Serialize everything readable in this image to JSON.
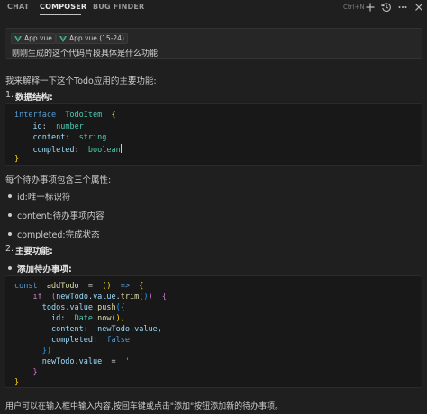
{
  "tabs": [
    {
      "label": "CHAT",
      "active": false
    },
    {
      "label": "COMPOSER",
      "active": true
    },
    {
      "label": "BUG FINDER",
      "active": false
    }
  ],
  "toolbar": {
    "shortcut": "Ctrl+N",
    "icons": [
      "plus-icon",
      "history-icon",
      "more-icon",
      "close-icon"
    ]
  },
  "context": {
    "chips": [
      "App.vue",
      "App.vue (15-24)"
    ],
    "question": "刚刚生成的这个代码片段具体是什么功能"
  },
  "answer": {
    "intro": "我来解释一下这个Todo应用的主要功能:",
    "section1_num": "1.",
    "section1_title": "数据结构:",
    "code1": {
      "line1": {
        "kw": "interface",
        "name": "TodoItem",
        "open": "{"
      },
      "line2": {
        "prop": "id",
        "type": "number"
      },
      "line3": {
        "prop": "content",
        "type": "string"
      },
      "line4": {
        "prop": "completed",
        "type": "boolean"
      },
      "line5": {
        "close": "}"
      }
    },
    "props_intro": "每个待办事项包含三个属性:",
    "props": [
      "id:唯一标识符",
      "content:待办事项内容",
      "completed:完成状态"
    ],
    "section2_num": "2.",
    "section2_title": "主要功能:",
    "bullet2_title": "添加待办事项:",
    "code2": {
      "l1": {
        "kw": "const",
        "name": "addTodo",
        "eq": "=",
        "params": "()",
        "arrow": "=>",
        "open": "{"
      },
      "l2": {
        "kw": "if",
        "cond_open": "(",
        "obj": "newTodo",
        "dot1": ".",
        "val": "value",
        "dot2": ".",
        "fn": "trim",
        "call": "()",
        "cond_close": ")",
        "open": "{"
      },
      "l3": {
        "obj": "todos",
        "dot1": ".",
        "val": "value",
        "dot2": ".",
        "fn": "push",
        "open": "({"
      },
      "l4": {
        "prop": "id",
        "obj": "Date",
        "dot": ".",
        "fn": "now",
        "call": "(),"
      },
      "l5": {
        "prop": "content",
        "obj": "newTodo",
        "dot": ".",
        "val": "value",
        "comma": ","
      },
      "l6": {
        "prop": "completed",
        "val": "false"
      },
      "l7": {
        "close": "})"
      },
      "l8": {
        "obj": "newTodo",
        "dot": ".",
        "val": "value",
        "eq": "=",
        "str": "''"
      },
      "l9": {
        "close": "}"
      },
      "l10": {
        "close": "}"
      }
    },
    "footer": "用户可以在输入框中输入内容,按回车键或点击\"添加\"按钮添加新的待办事项。"
  }
}
